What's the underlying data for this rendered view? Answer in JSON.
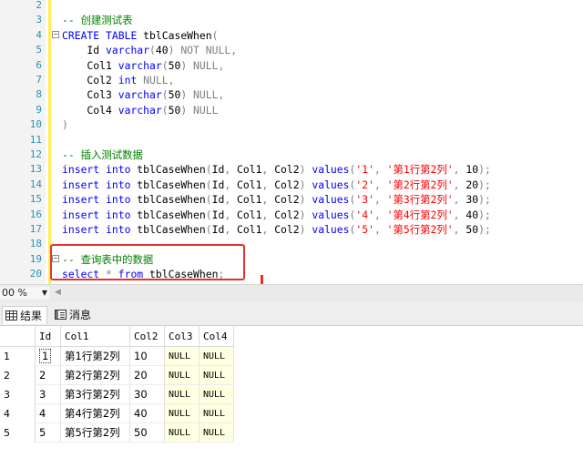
{
  "editor": {
    "lines": [
      {
        "n": "2",
        "parts": []
      },
      {
        "n": "3",
        "parts": [
          {
            "t": "-- 创建测试表",
            "c": "cm"
          }
        ]
      },
      {
        "n": "4",
        "fold": "−",
        "parts": [
          {
            "t": "CREATE",
            "c": "kw"
          },
          {
            "t": " "
          },
          {
            "t": "TABLE",
            "c": "kw"
          },
          {
            "t": " tblCaseWhen"
          },
          {
            "t": "(",
            "c": "gr"
          }
        ]
      },
      {
        "n": "5",
        "parts": [
          {
            "t": "    Id "
          },
          {
            "t": "varchar",
            "c": "kw"
          },
          {
            "t": "(",
            "c": "gr"
          },
          {
            "t": "40"
          },
          {
            "t": ")",
            "c": "gr"
          },
          {
            "t": " "
          },
          {
            "t": "NOT NULL",
            "c": "gr"
          },
          {
            "t": ",",
            "c": "gr"
          }
        ]
      },
      {
        "n": "6",
        "parts": [
          {
            "t": "    Col1 "
          },
          {
            "t": "varchar",
            "c": "kw"
          },
          {
            "t": "(",
            "c": "gr"
          },
          {
            "t": "50"
          },
          {
            "t": ")",
            "c": "gr"
          },
          {
            "t": " "
          },
          {
            "t": "NULL",
            "c": "gr"
          },
          {
            "t": ",",
            "c": "gr"
          }
        ]
      },
      {
        "n": "7",
        "parts": [
          {
            "t": "    Col2 "
          },
          {
            "t": "int",
            "c": "kw"
          },
          {
            "t": " "
          },
          {
            "t": "NULL",
            "c": "gr"
          },
          {
            "t": ",",
            "c": "gr"
          }
        ]
      },
      {
        "n": "8",
        "parts": [
          {
            "t": "    Col3 "
          },
          {
            "t": "varchar",
            "c": "kw"
          },
          {
            "t": "(",
            "c": "gr"
          },
          {
            "t": "50"
          },
          {
            "t": ")",
            "c": "gr"
          },
          {
            "t": " "
          },
          {
            "t": "NULL",
            "c": "gr"
          },
          {
            "t": ",",
            "c": "gr"
          }
        ]
      },
      {
        "n": "9",
        "parts": [
          {
            "t": "    Col4 "
          },
          {
            "t": "varchar",
            "c": "kw"
          },
          {
            "t": "(",
            "c": "gr"
          },
          {
            "t": "50"
          },
          {
            "t": ")",
            "c": "gr"
          },
          {
            "t": " "
          },
          {
            "t": "NULL",
            "c": "gr"
          }
        ]
      },
      {
        "n": "10",
        "parts": [
          {
            "t": ")",
            "c": "gr"
          }
        ]
      },
      {
        "n": "11",
        "parts": []
      },
      {
        "n": "12",
        "parts": [
          {
            "t": "-- 插入测试数据",
            "c": "cm"
          }
        ]
      },
      {
        "n": "13",
        "parts": [
          {
            "t": "insert",
            "c": "kw"
          },
          {
            "t": " "
          },
          {
            "t": "into",
            "c": "kw"
          },
          {
            "t": " tblCaseWhen"
          },
          {
            "t": "(",
            "c": "gr"
          },
          {
            "t": "Id"
          },
          {
            "t": ",",
            "c": "gr"
          },
          {
            "t": " Col1"
          },
          {
            "t": ",",
            "c": "gr"
          },
          {
            "t": " Col2"
          },
          {
            "t": ")",
            "c": "gr"
          },
          {
            "t": " "
          },
          {
            "t": "values",
            "c": "kw"
          },
          {
            "t": "(",
            "c": "gr"
          },
          {
            "t": "'1'",
            "c": "st"
          },
          {
            "t": ", ",
            "c": "gr"
          },
          {
            "t": "'第1行第2列'",
            "c": "st"
          },
          {
            "t": ", ",
            "c": "gr"
          },
          {
            "t": "10"
          },
          {
            "t": ");",
            "c": "gr"
          }
        ]
      },
      {
        "n": "14",
        "parts": [
          {
            "t": "insert",
            "c": "kw"
          },
          {
            "t": " "
          },
          {
            "t": "into",
            "c": "kw"
          },
          {
            "t": " tblCaseWhen"
          },
          {
            "t": "(",
            "c": "gr"
          },
          {
            "t": "Id"
          },
          {
            "t": ",",
            "c": "gr"
          },
          {
            "t": " Col1"
          },
          {
            "t": ",",
            "c": "gr"
          },
          {
            "t": " Col2"
          },
          {
            "t": ")",
            "c": "gr"
          },
          {
            "t": " "
          },
          {
            "t": "values",
            "c": "kw"
          },
          {
            "t": "(",
            "c": "gr"
          },
          {
            "t": "'2'",
            "c": "st"
          },
          {
            "t": ", ",
            "c": "gr"
          },
          {
            "t": "'第2行第2列'",
            "c": "st"
          },
          {
            "t": ", ",
            "c": "gr"
          },
          {
            "t": "20"
          },
          {
            "t": ");",
            "c": "gr"
          }
        ]
      },
      {
        "n": "15",
        "parts": [
          {
            "t": "insert",
            "c": "kw"
          },
          {
            "t": " "
          },
          {
            "t": "into",
            "c": "kw"
          },
          {
            "t": " tblCaseWhen"
          },
          {
            "t": "(",
            "c": "gr"
          },
          {
            "t": "Id"
          },
          {
            "t": ",",
            "c": "gr"
          },
          {
            "t": " Col1"
          },
          {
            "t": ",",
            "c": "gr"
          },
          {
            "t": " Col2"
          },
          {
            "t": ")",
            "c": "gr"
          },
          {
            "t": " "
          },
          {
            "t": "values",
            "c": "kw"
          },
          {
            "t": "(",
            "c": "gr"
          },
          {
            "t": "'3'",
            "c": "st"
          },
          {
            "t": ", ",
            "c": "gr"
          },
          {
            "t": "'第3行第2列'",
            "c": "st"
          },
          {
            "t": ", ",
            "c": "gr"
          },
          {
            "t": "30"
          },
          {
            "t": ");",
            "c": "gr"
          }
        ]
      },
      {
        "n": "16",
        "parts": [
          {
            "t": "insert",
            "c": "kw"
          },
          {
            "t": " "
          },
          {
            "t": "into",
            "c": "kw"
          },
          {
            "t": " tblCaseWhen"
          },
          {
            "t": "(",
            "c": "gr"
          },
          {
            "t": "Id"
          },
          {
            "t": ",",
            "c": "gr"
          },
          {
            "t": " Col1"
          },
          {
            "t": ",",
            "c": "gr"
          },
          {
            "t": " Col2"
          },
          {
            "t": ")",
            "c": "gr"
          },
          {
            "t": " "
          },
          {
            "t": "values",
            "c": "kw"
          },
          {
            "t": "(",
            "c": "gr"
          },
          {
            "t": "'4'",
            "c": "st"
          },
          {
            "t": ", ",
            "c": "gr"
          },
          {
            "t": "'第4行第2列'",
            "c": "st"
          },
          {
            "t": ", ",
            "c": "gr"
          },
          {
            "t": "40"
          },
          {
            "t": ");",
            "c": "gr"
          }
        ]
      },
      {
        "n": "17",
        "parts": [
          {
            "t": "insert",
            "c": "kw"
          },
          {
            "t": " "
          },
          {
            "t": "into",
            "c": "kw"
          },
          {
            "t": " tblCaseWhen"
          },
          {
            "t": "(",
            "c": "gr"
          },
          {
            "t": "Id"
          },
          {
            "t": ",",
            "c": "gr"
          },
          {
            "t": " Col1"
          },
          {
            "t": ",",
            "c": "gr"
          },
          {
            "t": " Col2"
          },
          {
            "t": ")",
            "c": "gr"
          },
          {
            "t": " "
          },
          {
            "t": "values",
            "c": "kw"
          },
          {
            "t": "(",
            "c": "gr"
          },
          {
            "t": "'5'",
            "c": "st"
          },
          {
            "t": ", ",
            "c": "gr"
          },
          {
            "t": "'第5行第2列'",
            "c": "st"
          },
          {
            "t": ", ",
            "c": "gr"
          },
          {
            "t": "50"
          },
          {
            "t": ");",
            "c": "gr"
          }
        ]
      },
      {
        "n": "18",
        "parts": []
      },
      {
        "n": "19",
        "fold": "−",
        "parts": [
          {
            "t": "-- 查询表中的数据",
            "c": "cm"
          }
        ]
      },
      {
        "n": "20",
        "parts": [
          {
            "t": "select",
            "c": "kw"
          },
          {
            "t": " "
          },
          {
            "t": "*",
            "c": "gr"
          },
          {
            "t": " "
          },
          {
            "t": "from",
            "c": "kw"
          },
          {
            "t": " tblCaseWhen"
          },
          {
            "t": ";",
            "c": "gr"
          }
        ]
      }
    ]
  },
  "statusbar": {
    "zoom": "00 %"
  },
  "tabs": [
    {
      "label": "结果",
      "icon": "grid-icon"
    },
    {
      "label": "消息",
      "icon": "message-icon"
    }
  ],
  "grid": {
    "columns": [
      "Id",
      "Col1",
      "Col2",
      "Col3",
      "Col4"
    ],
    "rows": [
      {
        "rownum": "1",
        "cells": [
          "1",
          "第1行第2列",
          "10",
          "NULL",
          "NULL"
        ]
      },
      {
        "rownum": "2",
        "cells": [
          "2",
          "第2行第2列",
          "20",
          "NULL",
          "NULL"
        ]
      },
      {
        "rownum": "3",
        "cells": [
          "3",
          "第3行第2列",
          "30",
          "NULL",
          "NULL"
        ]
      },
      {
        "rownum": "4",
        "cells": [
          "4",
          "第4行第2列",
          "40",
          "NULL",
          "NULL"
        ]
      },
      {
        "rownum": "5",
        "cells": [
          "5",
          "第5行第2列",
          "50",
          "NULL",
          "NULL"
        ]
      }
    ]
  },
  "colors": {
    "annotation": "#e8312a",
    "null_cell": "#ffffe1",
    "keyword": "#0000ff",
    "comment": "#008000",
    "string": "#ff0000"
  }
}
